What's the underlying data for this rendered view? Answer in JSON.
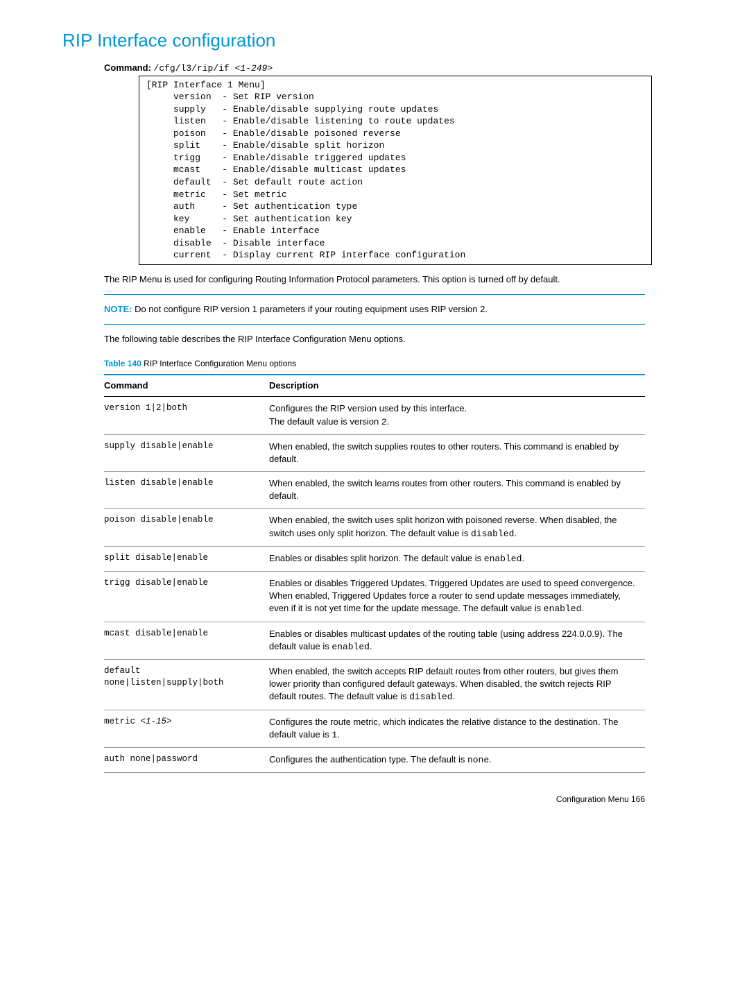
{
  "heading": "RIP Interface configuration",
  "commandLabel": "Command:",
  "commandPath": "/cfg/l3/rip/if ",
  "commandArg": "<1-249>",
  "menuBlock": "[RIP Interface 1 Menu]\n     version  - Set RIP version\n     supply   - Enable/disable supplying route updates\n     listen   - Enable/disable listening to route updates\n     poison   - Enable/disable poisoned reverse\n     split    - Enable/disable split horizon\n     trigg    - Enable/disable triggered updates\n     mcast    - Enable/disable multicast updates\n     default  - Set default route action\n     metric   - Set metric\n     auth     - Set authentication type\n     key      - Set authentication key\n     enable   - Enable interface\n     disable  - Disable interface\n     current  - Display current RIP interface configuration",
  "intro": "The RIP Menu is used for configuring Routing Information Protocol parameters. This option is turned off by default.",
  "noteLabel": "NOTE:",
  "noteText": " Do not configure RIP version 1 parameters if your routing equipment uses RIP version 2.",
  "tableIntro": "The following table describes the RIP Interface Configuration Menu options.",
  "tableCaptionLabel": "Table 140",
  "tableCaptionText": "  RIP Interface Configuration Menu options",
  "tableHeaders": {
    "cmd": "Command",
    "desc": "Description"
  },
  "rows": [
    {
      "cmd": "version 1|2|both",
      "desc_pre": "Configures the RIP version used by this interface.\nThe default value is version ",
      "code": "2",
      "desc_post": "."
    },
    {
      "cmd": "supply disable|enable",
      "desc_pre": "When enabled, the switch supplies routes to other routers. This command is enabled by default.",
      "code": "",
      "desc_post": ""
    },
    {
      "cmd": "listen disable|enable",
      "desc_pre": "When enabled, the switch learns routes from other routers. This command is enabled by default.",
      "code": "",
      "desc_post": ""
    },
    {
      "cmd": "poison disable|enable",
      "desc_pre": "When enabled, the switch uses split horizon with poisoned reverse. When disabled, the switch uses only split horizon. The default value is ",
      "code": "disabled",
      "desc_post": "."
    },
    {
      "cmd": "split disable|enable",
      "desc_pre": "Enables or disables split horizon. The default value is ",
      "code": "enabled",
      "desc_post": "."
    },
    {
      "cmd": "trigg disable|enable",
      "desc_pre": "Enables or disables Triggered Updates. Triggered Updates are used to speed convergence. When enabled, Triggered Updates force a router to send update messages immediately, even if it is not yet time for the update message. The default value is ",
      "code": "enabled",
      "desc_post": "."
    },
    {
      "cmd": "mcast disable|enable",
      "desc_pre": "Enables or disables multicast updates of the routing table (using address 224.0.0.9). The default value is ",
      "code": "enabled",
      "desc_post": "."
    },
    {
      "cmd": "default none|listen|supply|both",
      "desc_pre": "When enabled, the switch accepts RIP default routes from other routers, but gives them lower priority than configured default gateways. When disabled, the switch rejects RIP default routes. The default value is ",
      "code": "disabled",
      "desc_post": "."
    },
    {
      "cmd_pre": "metric ",
      "cmd_arg": "<1-15>",
      "desc_pre": "Configures the route metric, which indicates the relative distance to the destination. The default value is ",
      "code": "1",
      "desc_post": "."
    },
    {
      "cmd": "auth none|password",
      "desc_pre": "Configures the authentication type. The default is ",
      "code": "none",
      "desc_post": "."
    }
  ],
  "footer": "Configuration Menu   166"
}
